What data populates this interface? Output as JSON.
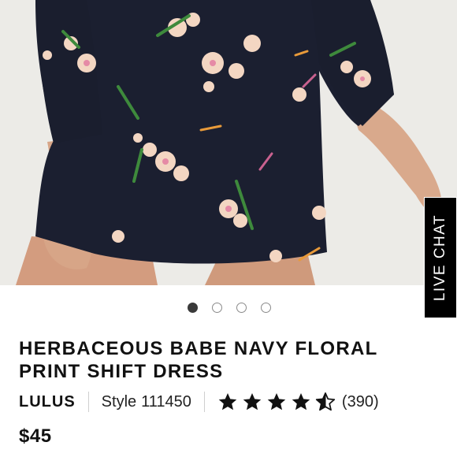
{
  "gallery": {
    "image_alt": "Navy floral print shift dress",
    "dots": [
      "slide 1",
      "slide 2",
      "slide 3",
      "slide 4"
    ],
    "active_index": 0
  },
  "live_chat": {
    "label": "LIVE CHAT"
  },
  "product": {
    "title": "HERBACEOUS BABE NAVY FLORAL PRINT SHIFT DRESS",
    "brand": "LULUS",
    "style_label": "Style",
    "style_number": "111450",
    "rating": 4.5,
    "rating_max": 5,
    "review_count": "(390)",
    "price": "$45"
  },
  "colors": {
    "dress": "#1b1f30",
    "skin": "#d7a68a",
    "live_chat_bg": "#000000",
    "star": "#111111"
  }
}
